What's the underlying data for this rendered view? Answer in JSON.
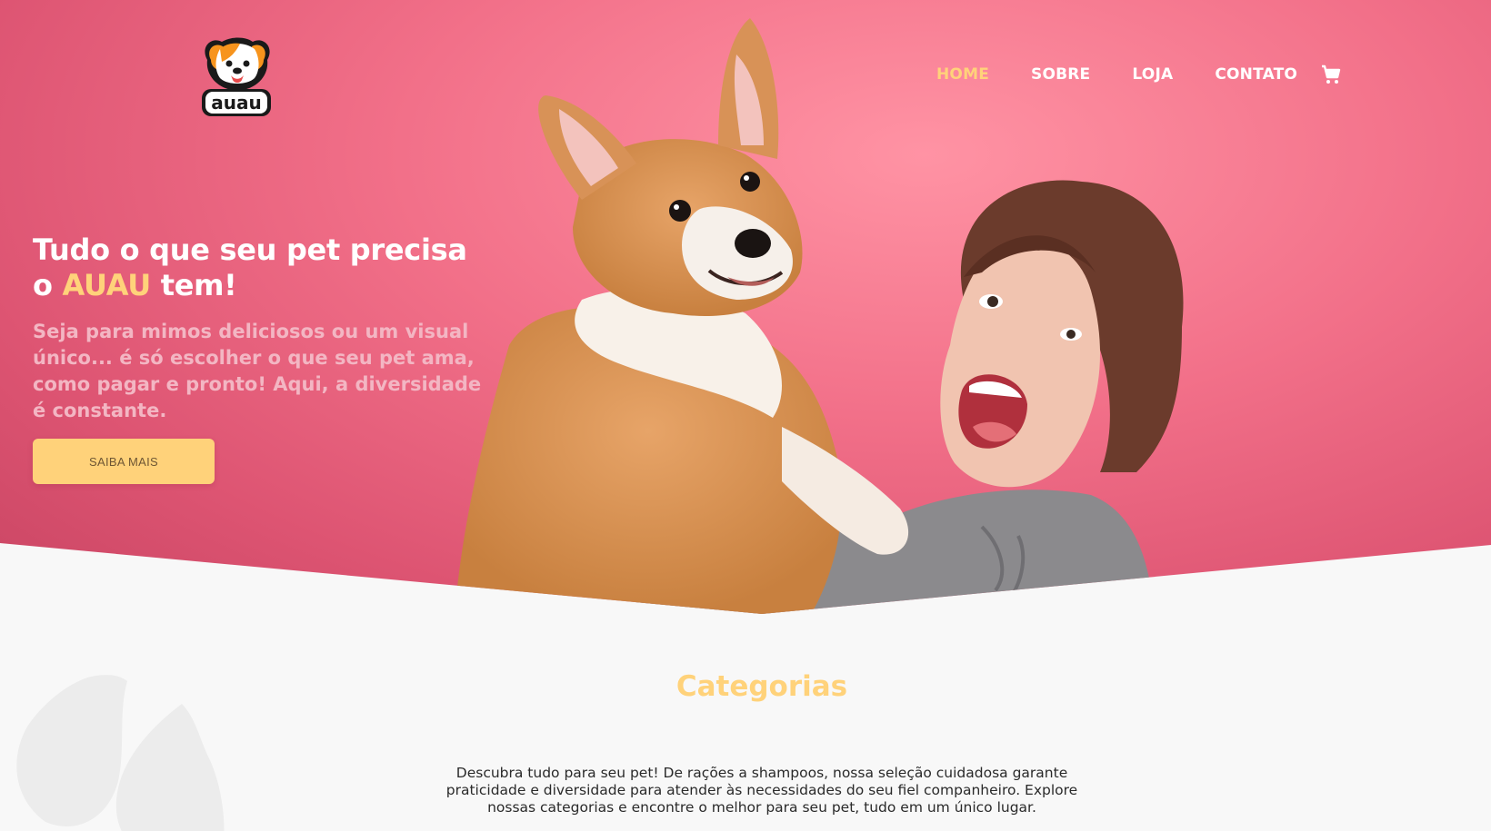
{
  "brand": {
    "logo_text": "auau",
    "colors": {
      "accent": "#ffd27a",
      "hero_pink": "#f27089",
      "background": "#f8f8f8"
    }
  },
  "nav": {
    "items": [
      {
        "label": "HOME",
        "active": true
      },
      {
        "label": "SOBRE",
        "active": false
      },
      {
        "label": "LOJA",
        "active": false
      },
      {
        "label": "CONTATO",
        "active": false
      }
    ],
    "cart_icon": "shopping-cart-icon"
  },
  "hero": {
    "title_line1": "Tudo o que seu pet precisa",
    "title_line2_prefix": "o ",
    "title_brand": "AUAU",
    "title_line2_suffix": " tem!",
    "subtitle": "Seja para mimos deliciosos ou um visual único... é só escolher o que seu pet ama, como pagar e pronto! Aqui, a diversidade é constante.",
    "cta_label": "SAIBA MAIS",
    "image": "corgi-and-woman-photo"
  },
  "categories": {
    "title": "Categorias",
    "description": "Descubra tudo para seu pet! De rações a shampoos, nossa seleção cuidadosa garante praticidade e diversidade para atender às necessidades do seu fiel companheiro. Explore nossas categorias e encontre o melhor para seu pet, tudo em um único lugar.",
    "decoration": "paw-print-icon"
  }
}
